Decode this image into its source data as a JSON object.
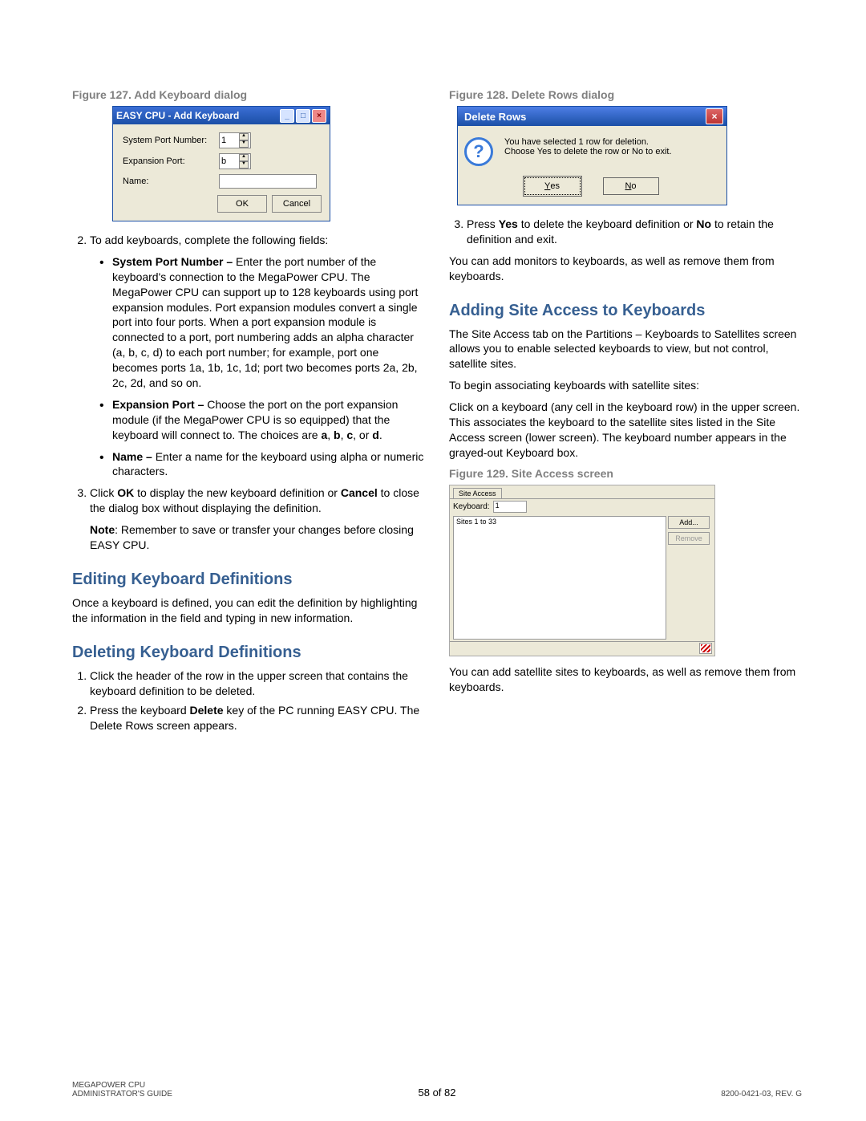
{
  "figures": {
    "f127": {
      "caption": "Figure 127. Add Keyboard dialog",
      "title": "EASY CPU - Add Keyboard",
      "labels": {
        "port": "System Port Number:",
        "exp": "Expansion Port:",
        "name": "Name:"
      },
      "values": {
        "port": "1",
        "exp": "b"
      },
      "buttons": {
        "ok": "OK",
        "cancel": "Cancel"
      }
    },
    "f128": {
      "caption": "Figure 128. Delete Rows dialog",
      "title": "Delete Rows",
      "msg1": "You have selected 1 row for deletion.",
      "msg2": "Choose Yes to delete the row or No to exit.",
      "yes": "Yes",
      "no": "No"
    },
    "f129": {
      "caption": "Figure 129. Site Access screen",
      "tab": "Site Access",
      "kb_label": "Keyboard:",
      "kb_value": "1",
      "add": "Add...",
      "remove": "Remove",
      "list_header": "Sites 1 to 33"
    }
  },
  "left": {
    "step2": "To add keyboards, complete the following fields:",
    "b1a": "System Port Number –",
    "b1b": " Enter the port number of the keyboard's connection to the MegaPower CPU. The MegaPower CPU can support up to 128 keyboards using port expansion modules. Port expansion modules convert a single port into four ports. When a port expansion module is connected to a port, port numbering adds an alpha character (a, b, c, d) to each port number; for example, port one becomes ports 1a, 1b, 1c, 1d; port two becomes ports 2a, 2b, 2c, 2d, and so on.",
    "b2a": "Expansion Port –",
    "b2b": " Choose the port on the port expansion module (if the MegaPower CPU is so equipped) that the keyboard will connect to. The choices are ",
    "b2c": "a",
    "b2d": "b",
    "b2e": "c",
    "b2f": "d",
    "b3a": "Name –",
    "b3b": " Enter a name for the keyboard using alpha or numeric characters.",
    "step3a": "Click ",
    "step3b": "OK",
    "step3c": " to display the new keyboard definition or ",
    "step3d": "Cancel",
    "step3e": " to close the dialog box without displaying the definition.",
    "note_a": "Note",
    "note_b": ": Remember to save or transfer your changes before closing EASY CPU.",
    "h_edit": "Editing Keyboard Definitions",
    "p_edit": "Once a keyboard is defined, you can edit the definition by highlighting the information in the field and typing in new information.",
    "h_del": "Deleting Keyboard Definitions",
    "d1": "Click the header of the row in the upper screen that contains the keyboard definition to be deleted.",
    "d2a": "Press the keyboard ",
    "d2b": "Delete",
    "d2c": " key of the PC running EASY CPU. The Delete Rows screen appears."
  },
  "right": {
    "d3a": "Press ",
    "d3b": "Yes",
    "d3c": " to delete the keyboard definition or ",
    "d3d": "No",
    "d3e": " to retain the definition and exit.",
    "p_addmon": "You can add monitors to keyboards, as well as remove them from keyboards.",
    "h_site": "Adding Site Access to Keyboards",
    "p_site1": "The Site Access tab on the Partitions – Keyboards to Satellites screen allows you to enable selected keyboards to view, but not control, satellite sites.",
    "p_site2": "To begin associating keyboards with satellite sites:",
    "p_site3": "Click on a keyboard (any cell in the keyboard row) in the upper screen. This associates the keyboard to the satellite sites listed in the Site Access screen (lower screen). The keyboard number appears in the grayed-out Keyboard box.",
    "p_after": "You can add satellite sites to keyboards, as well as remove them from keyboards."
  },
  "footer": {
    "l1": "MEGAPOWER CPU",
    "l2": "ADMINISTRATOR'S GUIDE",
    "center": "58 of 82",
    "right": "8200-0421-03, REV. G"
  }
}
